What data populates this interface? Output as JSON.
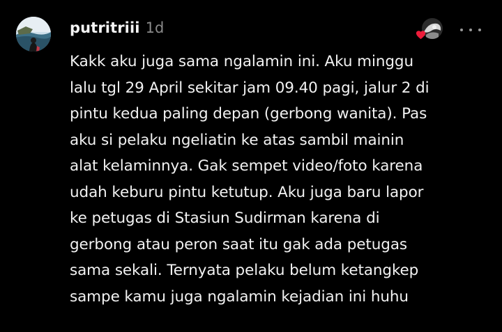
{
  "comment": {
    "username": "putritriii",
    "timestamp": "1d",
    "body_lines": [
      "Kakk aku juga sama ngalamin ini. Aku minggu",
      "lalu tgl 29 April sekitar jam 09.40 pagi, jalur 2 di",
      "pintu kedua paling depan (gerbong wanita). Pas",
      "aku si pelaku ngeliatin ke atas sambil mainin",
      "alat kelaminnya. Gak sempet video/foto karena",
      "udah keburu pintu ketutup. Aku juga baru lapor",
      "ke petugas di Stasiun Sudirman karena di",
      "gerbong atau peron saat itu gak ada petugas",
      "sama sekali. Ternyata pelaku belum ketangkep",
      "sampe kamu juga ngalamin kejadian ini huhu"
    ],
    "icons": {
      "liked_by_creator": "heart-icon",
      "more": "more-options-icon"
    },
    "colors": {
      "background": "#000000",
      "text": "#f5f5f5",
      "muted": "#8a8a8a",
      "heart": "#ed1c3a"
    }
  }
}
